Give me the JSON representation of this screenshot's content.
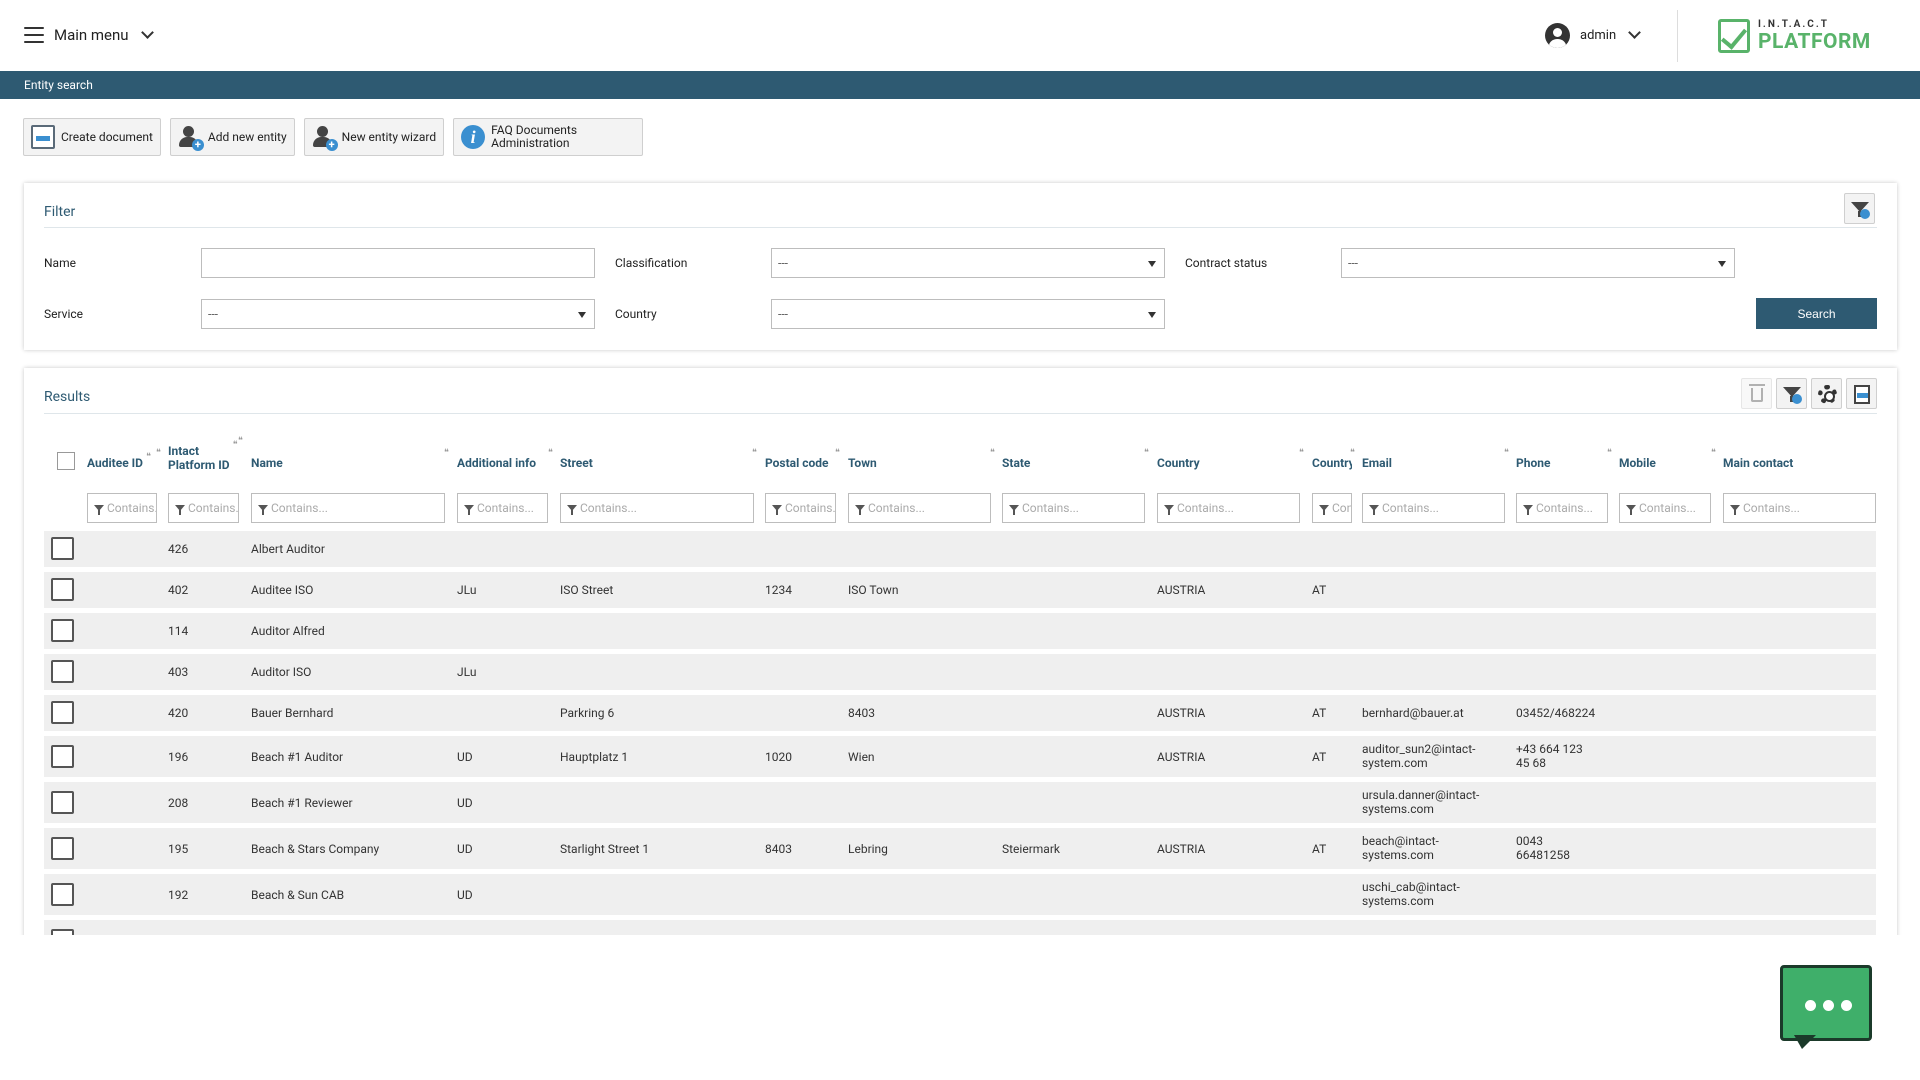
{
  "header": {
    "main_menu_label": "Main menu",
    "user_label": "admin",
    "logo_top": "I.N.T.A.C.T",
    "logo_bottom": "PLATFORM"
  },
  "breadcrumb": "Entity search",
  "toolbar": {
    "create_document": "Create document",
    "add_new_entity": "Add new entity",
    "new_entity_wizard": "New entity wizard",
    "faq_line1": "FAQ Documents",
    "faq_line2": "Administration"
  },
  "filter": {
    "title": "Filter",
    "name_label": "Name",
    "name_value": "",
    "classification_label": "Classification",
    "classification_value": "---",
    "contract_status_label": "Contract status",
    "contract_status_value": "---",
    "service_label": "Service",
    "service_value": "---",
    "country_label": "Country",
    "country_value": "---",
    "search_label": "Search"
  },
  "results": {
    "title": "Results",
    "columns": {
      "auditee_id": "Auditee ID",
      "platform_id_1": "Intact",
      "platform_id_2": "Platform ID",
      "name": "Name",
      "additional_info": "Additional info",
      "street": "Street",
      "postal_code": "Postal code",
      "town": "Town",
      "state": "State",
      "country": "Country",
      "country_code": "Country",
      "email": "Email",
      "phone": "Phone",
      "mobile": "Mobile",
      "main_contact": "Main contact"
    },
    "filter_placeholders": {
      "auditee_id": "Contains...",
      "platform_id": "Contains...",
      "name": "Contains...",
      "additional_info": "Contains...",
      "street": "Contains...",
      "postal_code": "Contains...",
      "town": "Contains...",
      "state": "Contains...",
      "country": "Contains...",
      "country_code": "Contains...",
      "email": "Contains...",
      "phone": "Contains...",
      "mobile": "Contains...",
      "main_contact": "Contains..."
    },
    "rows": [
      {
        "id": "426",
        "name": "Albert Auditor",
        "info": "",
        "street": "",
        "postal": "",
        "town": "",
        "state": "",
        "country": "",
        "cc": "",
        "email1": "",
        "email2": "",
        "phone1": "",
        "phone2": ""
      },
      {
        "id": "402",
        "name": "Auditee ISO",
        "info": "JLu",
        "street": "ISO Street",
        "postal": "1234",
        "town": "ISO Town",
        "state": "",
        "country": "AUSTRIA",
        "cc": "AT",
        "email1": "",
        "email2": "",
        "phone1": "",
        "phone2": ""
      },
      {
        "id": "114",
        "name": "Auditor Alfred",
        "info": "",
        "street": "",
        "postal": "",
        "town": "",
        "state": "",
        "country": "",
        "cc": "",
        "email1": "",
        "email2": "",
        "phone1": "",
        "phone2": ""
      },
      {
        "id": "403",
        "name": "Auditor ISO",
        "info": "JLu",
        "street": "",
        "postal": "",
        "town": "",
        "state": "",
        "country": "",
        "cc": "",
        "email1": "",
        "email2": "",
        "phone1": "",
        "phone2": ""
      },
      {
        "id": "420",
        "name": "Bauer Bernhard",
        "info": "",
        "street": "Parkring 6",
        "postal": "",
        "town": "8403",
        "state": "",
        "country": "AUSTRIA",
        "cc": "AT",
        "email1": "bernhard@bauer.at",
        "email2": "",
        "phone1": "03452/468224",
        "phone2": ""
      },
      {
        "id": "196",
        "name": "Beach #1 Auditor",
        "info": "UD",
        "street": "Hauptplatz 1",
        "postal": "1020",
        "town": "Wien",
        "state": "",
        "country": "AUSTRIA",
        "cc": "AT",
        "email1": "auditor_sun2@intact-",
        "email2": "system.com",
        "phone1": "+43 664 123",
        "phone2": "45 68"
      },
      {
        "id": "208",
        "name": "Beach #1 Reviewer",
        "info": "UD",
        "street": "",
        "postal": "",
        "town": "",
        "state": "",
        "country": "",
        "cc": "",
        "email1": "ursula.danner@intact-",
        "email2": "systems.com",
        "phone1": "",
        "phone2": ""
      },
      {
        "id": "195",
        "name": "Beach & Stars Company",
        "info": "UD",
        "street": "Starlight Street 1",
        "postal": "8403",
        "town": "Lebring",
        "state": "Steiermark",
        "country": "AUSTRIA",
        "cc": "AT",
        "email1": "beach@intact-",
        "email2": "systems.com",
        "phone1": "0043",
        "phone2": "66481258"
      },
      {
        "id": "192",
        "name": "Beach & Sun CAB",
        "info": "UD",
        "street": "",
        "postal": "",
        "town": "",
        "state": "",
        "country": "",
        "cc": "",
        "email1": "uschi_cab@intact-",
        "email2": "systems.com",
        "phone1": "",
        "phone2": ""
      }
    ]
  },
  "colors": {
    "accent": "#2e5a72",
    "brand_green": "#59b36a",
    "chat_green": "#3faf6a"
  }
}
